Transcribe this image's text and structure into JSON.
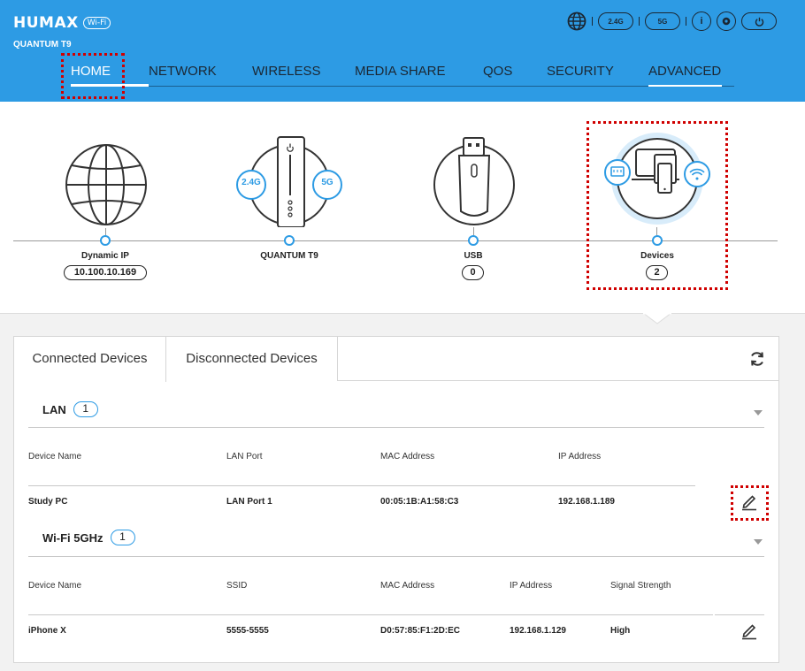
{
  "header": {
    "brand": "HUMAX",
    "brand_badge": "Wi-Fi",
    "model": "QUANTUM T9",
    "icons": {
      "globe": "globe-icon",
      "band_24": "2.4G",
      "band_5": "5G",
      "info": "i",
      "settings": "gear-icon",
      "power": "power-icon"
    }
  },
  "nav": {
    "items": [
      {
        "label": "HOME",
        "active": true
      },
      {
        "label": "NETWORK"
      },
      {
        "label": "WIRELESS"
      },
      {
        "label": "MEDIA SHARE"
      },
      {
        "label": "QOS"
      },
      {
        "label": "SECURITY"
      },
      {
        "label": "ADVANCED"
      }
    ]
  },
  "diagram": {
    "internet": {
      "label": "Dynamic IP",
      "value": "10.100.10.169"
    },
    "router": {
      "label": "QUANTUM T9",
      "band_24": "2.4G",
      "band_5": "5G"
    },
    "usb": {
      "label": "USB",
      "value": "0"
    },
    "devices": {
      "label": "Devices",
      "value": "2"
    }
  },
  "panel": {
    "tabs": [
      "Connected Devices",
      "Disconnected Devices"
    ],
    "lan": {
      "title": "LAN",
      "count": "1",
      "columns": [
        "Device Name",
        "LAN Port",
        "MAC Address",
        "IP Address"
      ],
      "rows": [
        {
          "name": "Study PC",
          "port": "LAN Port 1",
          "mac": "00:05:1B:A1:58:C3",
          "ip": "192.168.1.189"
        }
      ]
    },
    "wifi": {
      "title": "Wi-Fi 5GHz",
      "count": "1",
      "columns": [
        "Device Name",
        "SSID",
        "MAC Address",
        "IP Address",
        "Signal Strength"
      ],
      "rows": [
        {
          "name": "iPhone X",
          "ssid": "5555-5555",
          "mac": "D0:57:85:F1:2D:EC",
          "ip": "192.168.1.129",
          "signal": "High"
        }
      ]
    }
  },
  "colors": {
    "accent": "#2d9be4",
    "highlight": "#d00000"
  }
}
